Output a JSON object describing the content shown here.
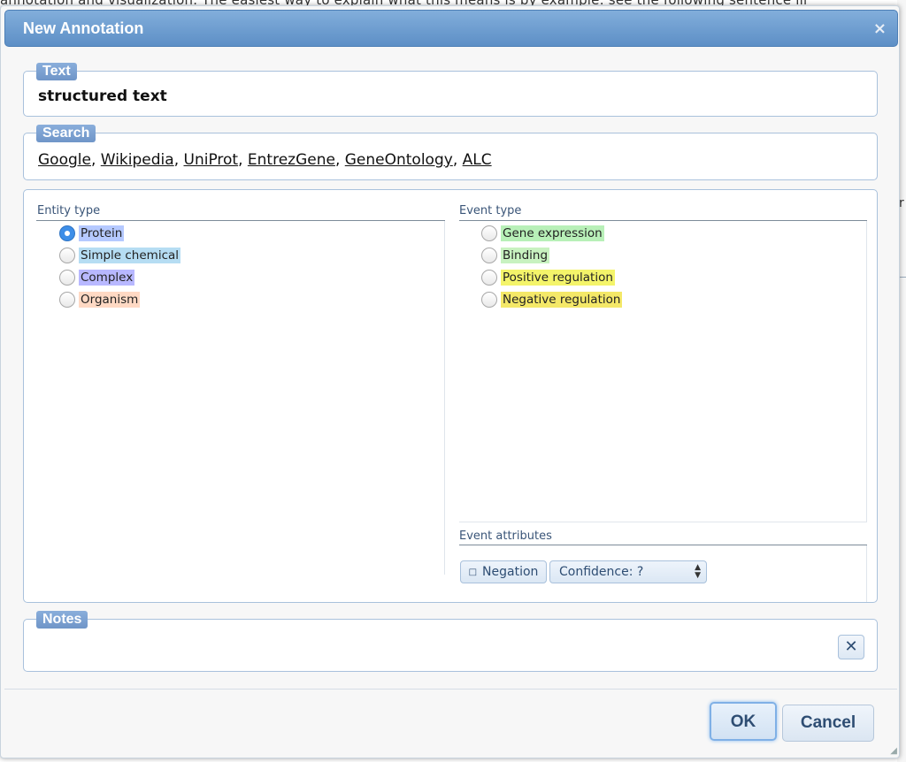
{
  "background": {
    "page_text": "annotation and visualization. The easiest way to explain what this means is by example: see the following sentence ill",
    "right_edge_char": "r"
  },
  "dialog": {
    "title": "New Annotation",
    "close_glyph": "×"
  },
  "text_section": {
    "legend": "Text",
    "value": "structured text"
  },
  "search_section": {
    "legend": "Search",
    "links": [
      "Google",
      "Wikipedia",
      "UniProt",
      "EntrezGene",
      "GeneOntology",
      "ALC"
    ],
    "separator": ", "
  },
  "entity_type": {
    "heading": "Entity type",
    "options": [
      {
        "label": "Protein",
        "color": "#b5c9ff",
        "checked": true
      },
      {
        "label": "Simple chemical",
        "color": "#b6ddf3",
        "checked": false
      },
      {
        "label": "Complex",
        "color": "#b8b8ff",
        "checked": false
      },
      {
        "label": "Organism",
        "color": "#ffd9c4",
        "checked": false
      }
    ]
  },
  "event_type": {
    "heading": "Event type",
    "options": [
      {
        "label": "Gene expression",
        "color": "#b8f0b8",
        "checked": false
      },
      {
        "label": "Binding",
        "color": "#c8f2c0",
        "checked": false
      },
      {
        "label": "Positive regulation",
        "color": "#f4f46a",
        "checked": false
      },
      {
        "label": "Negative regulation",
        "color": "#f4e868",
        "checked": false
      }
    ]
  },
  "event_attributes": {
    "heading": "Event attributes",
    "negation_label": "Negation",
    "checkbox_glyph": "□",
    "confidence_label": "Confidence: ?"
  },
  "notes_section": {
    "legend": "Notes",
    "clear_glyph": "✕"
  },
  "buttons": {
    "ok": "OK",
    "cancel": "Cancel"
  }
}
